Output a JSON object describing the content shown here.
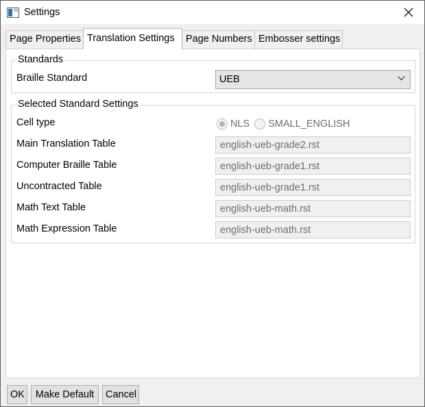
{
  "window": {
    "title": "Settings"
  },
  "tabs": [
    {
      "label": "Page Properties"
    },
    {
      "label": "Translation Settings",
      "active": true
    },
    {
      "label": "Page Numbers"
    },
    {
      "label": "Embosser settings"
    }
  ],
  "standards": {
    "group_title": "Standards",
    "braille_standard_label": "Braille Standard",
    "braille_standard_value": "UEB"
  },
  "selected": {
    "group_title": "Selected Standard Settings",
    "cell_type_label": "Cell type",
    "cell_type_options": [
      "NLS",
      "SMALL_ENGLISH"
    ],
    "cell_type_selected": "NLS",
    "rows": [
      {
        "label": "Main Translation Table",
        "value": "english-ueb-grade2.rst"
      },
      {
        "label": "Computer Braille Table",
        "value": "english-ueb-grade1.rst"
      },
      {
        "label": "Uncontracted Table",
        "value": "english-ueb-grade1.rst"
      },
      {
        "label": "Math Text Table",
        "value": "english-ueb-math.rst"
      },
      {
        "label": "Math Expression Table",
        "value": "english-ueb-math.rst"
      }
    ]
  },
  "buttons": {
    "ok": "OK",
    "make_default": "Make Default",
    "cancel": "Cancel"
  }
}
